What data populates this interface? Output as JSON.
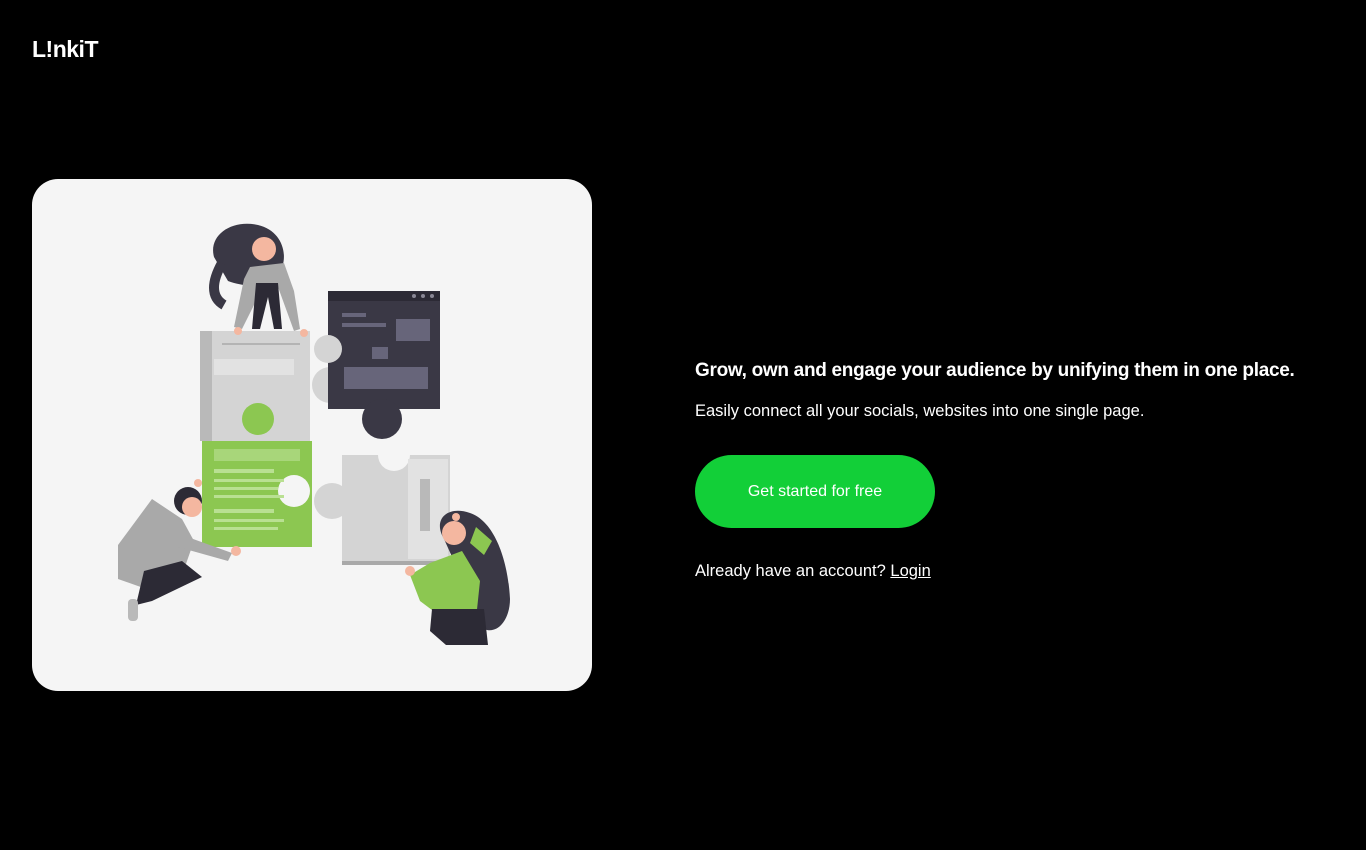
{
  "brand": {
    "logo_text": "L!nkiT"
  },
  "hero": {
    "headline": "Grow, own and engage your audience by unifying them in one place.",
    "subline": "Easily connect all your socials, websites into one single page.",
    "cta_label": "Get started for free",
    "account_prompt": "Already have an account?",
    "login_label": "Login"
  },
  "illustration": {
    "name": "puzzle-team-illustration"
  },
  "colors": {
    "background": "#000000",
    "card": "#f5f5f5",
    "accent": "#12cf38",
    "puzzle_green": "#8cc751",
    "puzzle_dark": "#3a3845",
    "puzzle_gray": "#cfcfcf"
  }
}
